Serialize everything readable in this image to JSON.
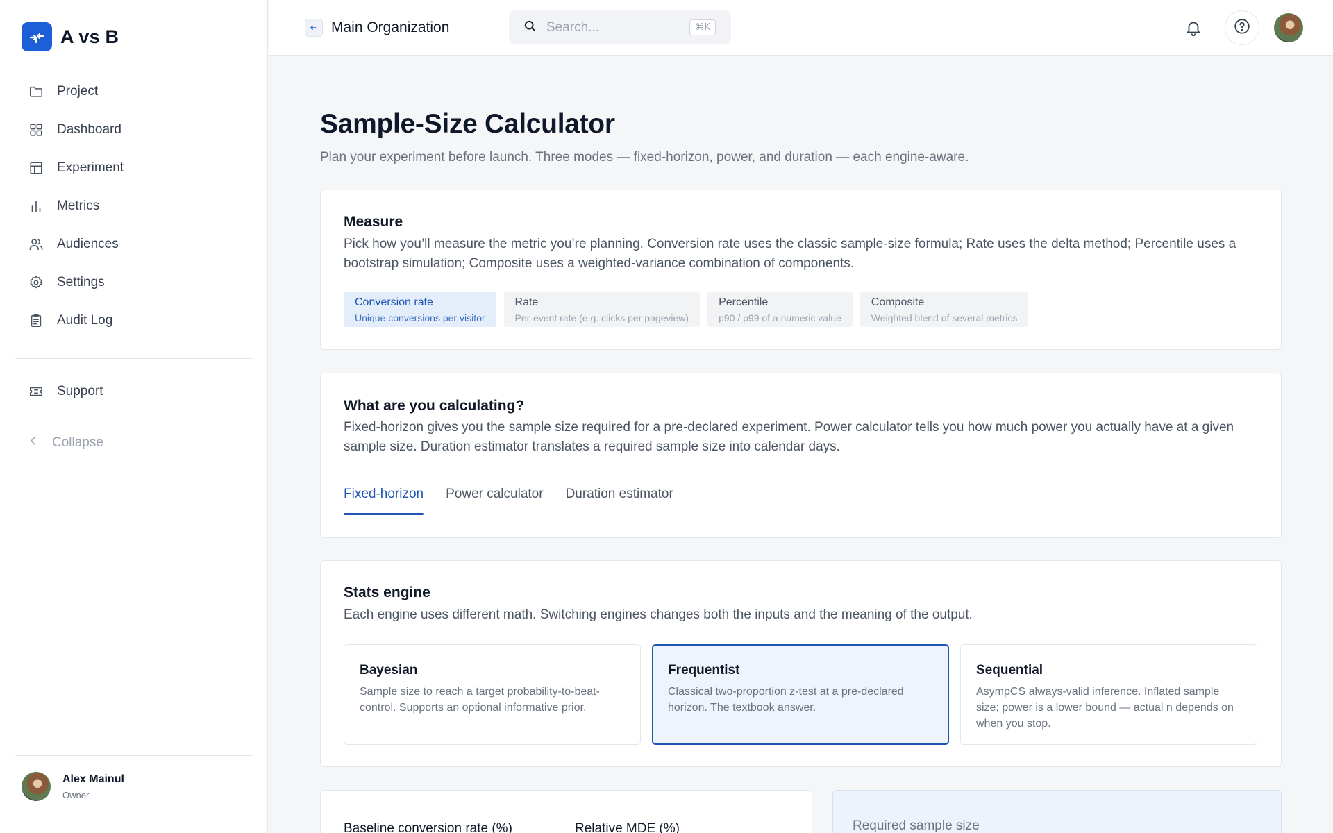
{
  "brand": {
    "name": "A vs B",
    "logo_icon": "arrows-in-icon",
    "accent": "#1d5fd6"
  },
  "sidebar": {
    "items": [
      {
        "label": "Project",
        "icon": "folder-icon"
      },
      {
        "label": "Dashboard",
        "icon": "grid-icon"
      },
      {
        "label": "Experiment",
        "icon": "table-icon"
      },
      {
        "label": "Metrics",
        "icon": "bar-chart-icon"
      },
      {
        "label": "Audiences",
        "icon": "users-icon"
      },
      {
        "label": "Settings",
        "icon": "gear-icon"
      },
      {
        "label": "Audit Log",
        "icon": "clipboard-icon"
      }
    ],
    "support": {
      "label": "Support",
      "icon": "ticket-icon"
    },
    "collapse": {
      "label": "Collapse",
      "icon": "chevron-left-icon"
    },
    "user": {
      "name": "Alex Mainul",
      "role": "Owner"
    }
  },
  "topbar": {
    "org_name": "Main Organization",
    "search": {
      "placeholder": "Search...",
      "shortcut": "⌘K"
    }
  },
  "page": {
    "title": "Sample-Size Calculator",
    "subtitle": "Plan your experiment before launch. Three modes — fixed-horizon, power, and duration — each engine-aware."
  },
  "measure": {
    "title": "Measure",
    "description": "Pick how you’ll measure the metric you’re planning. Conversion rate uses the classic sample-size formula; Rate uses the delta method; Percentile uses a bootstrap simulation; Composite uses a weighted-variance combination of components.",
    "options": [
      {
        "title": "Conversion rate",
        "desc": "Unique conversions per visitor",
        "selected": true
      },
      {
        "title": "Rate",
        "desc": "Per-event rate (e.g. clicks per pageview)",
        "selected": false
      },
      {
        "title": "Percentile",
        "desc": "p90 / p99 of a numeric value",
        "selected": false
      },
      {
        "title": "Composite",
        "desc": "Weighted blend of several metrics",
        "selected": false
      }
    ]
  },
  "calculating": {
    "title": "What are you calculating?",
    "description": "Fixed-horizon gives you the sample size required for a pre-declared experiment. Power calculator tells you how much power you actually have at a given sample size. Duration estimator translates a required sample size into calendar days.",
    "tabs": [
      "Fixed-horizon",
      "Power calculator",
      "Duration estimator"
    ],
    "active_tab": "Fixed-horizon"
  },
  "engine": {
    "title": "Stats engine",
    "description": "Each engine uses different math. Switching engines changes both the inputs and the meaning of the output.",
    "options": [
      {
        "title": "Bayesian",
        "desc": "Sample size to reach a target probability-to-beat-control. Supports an optional informative prior.",
        "selected": false
      },
      {
        "title": "Frequentist",
        "desc": "Classical two-proportion z-test at a pre-declared horizon. The textbook answer.",
        "selected": true
      },
      {
        "title": "Sequential",
        "desc": "AsympCS always-valid inference. Inflated sample size; power is a lower bound — actual n depends on when you stop.",
        "selected": false
      }
    ]
  },
  "form": {
    "baseline_label": "Baseline conversion rate (%)",
    "mde_label": "Relative MDE (%)"
  },
  "result": {
    "label": "Required sample size"
  }
}
